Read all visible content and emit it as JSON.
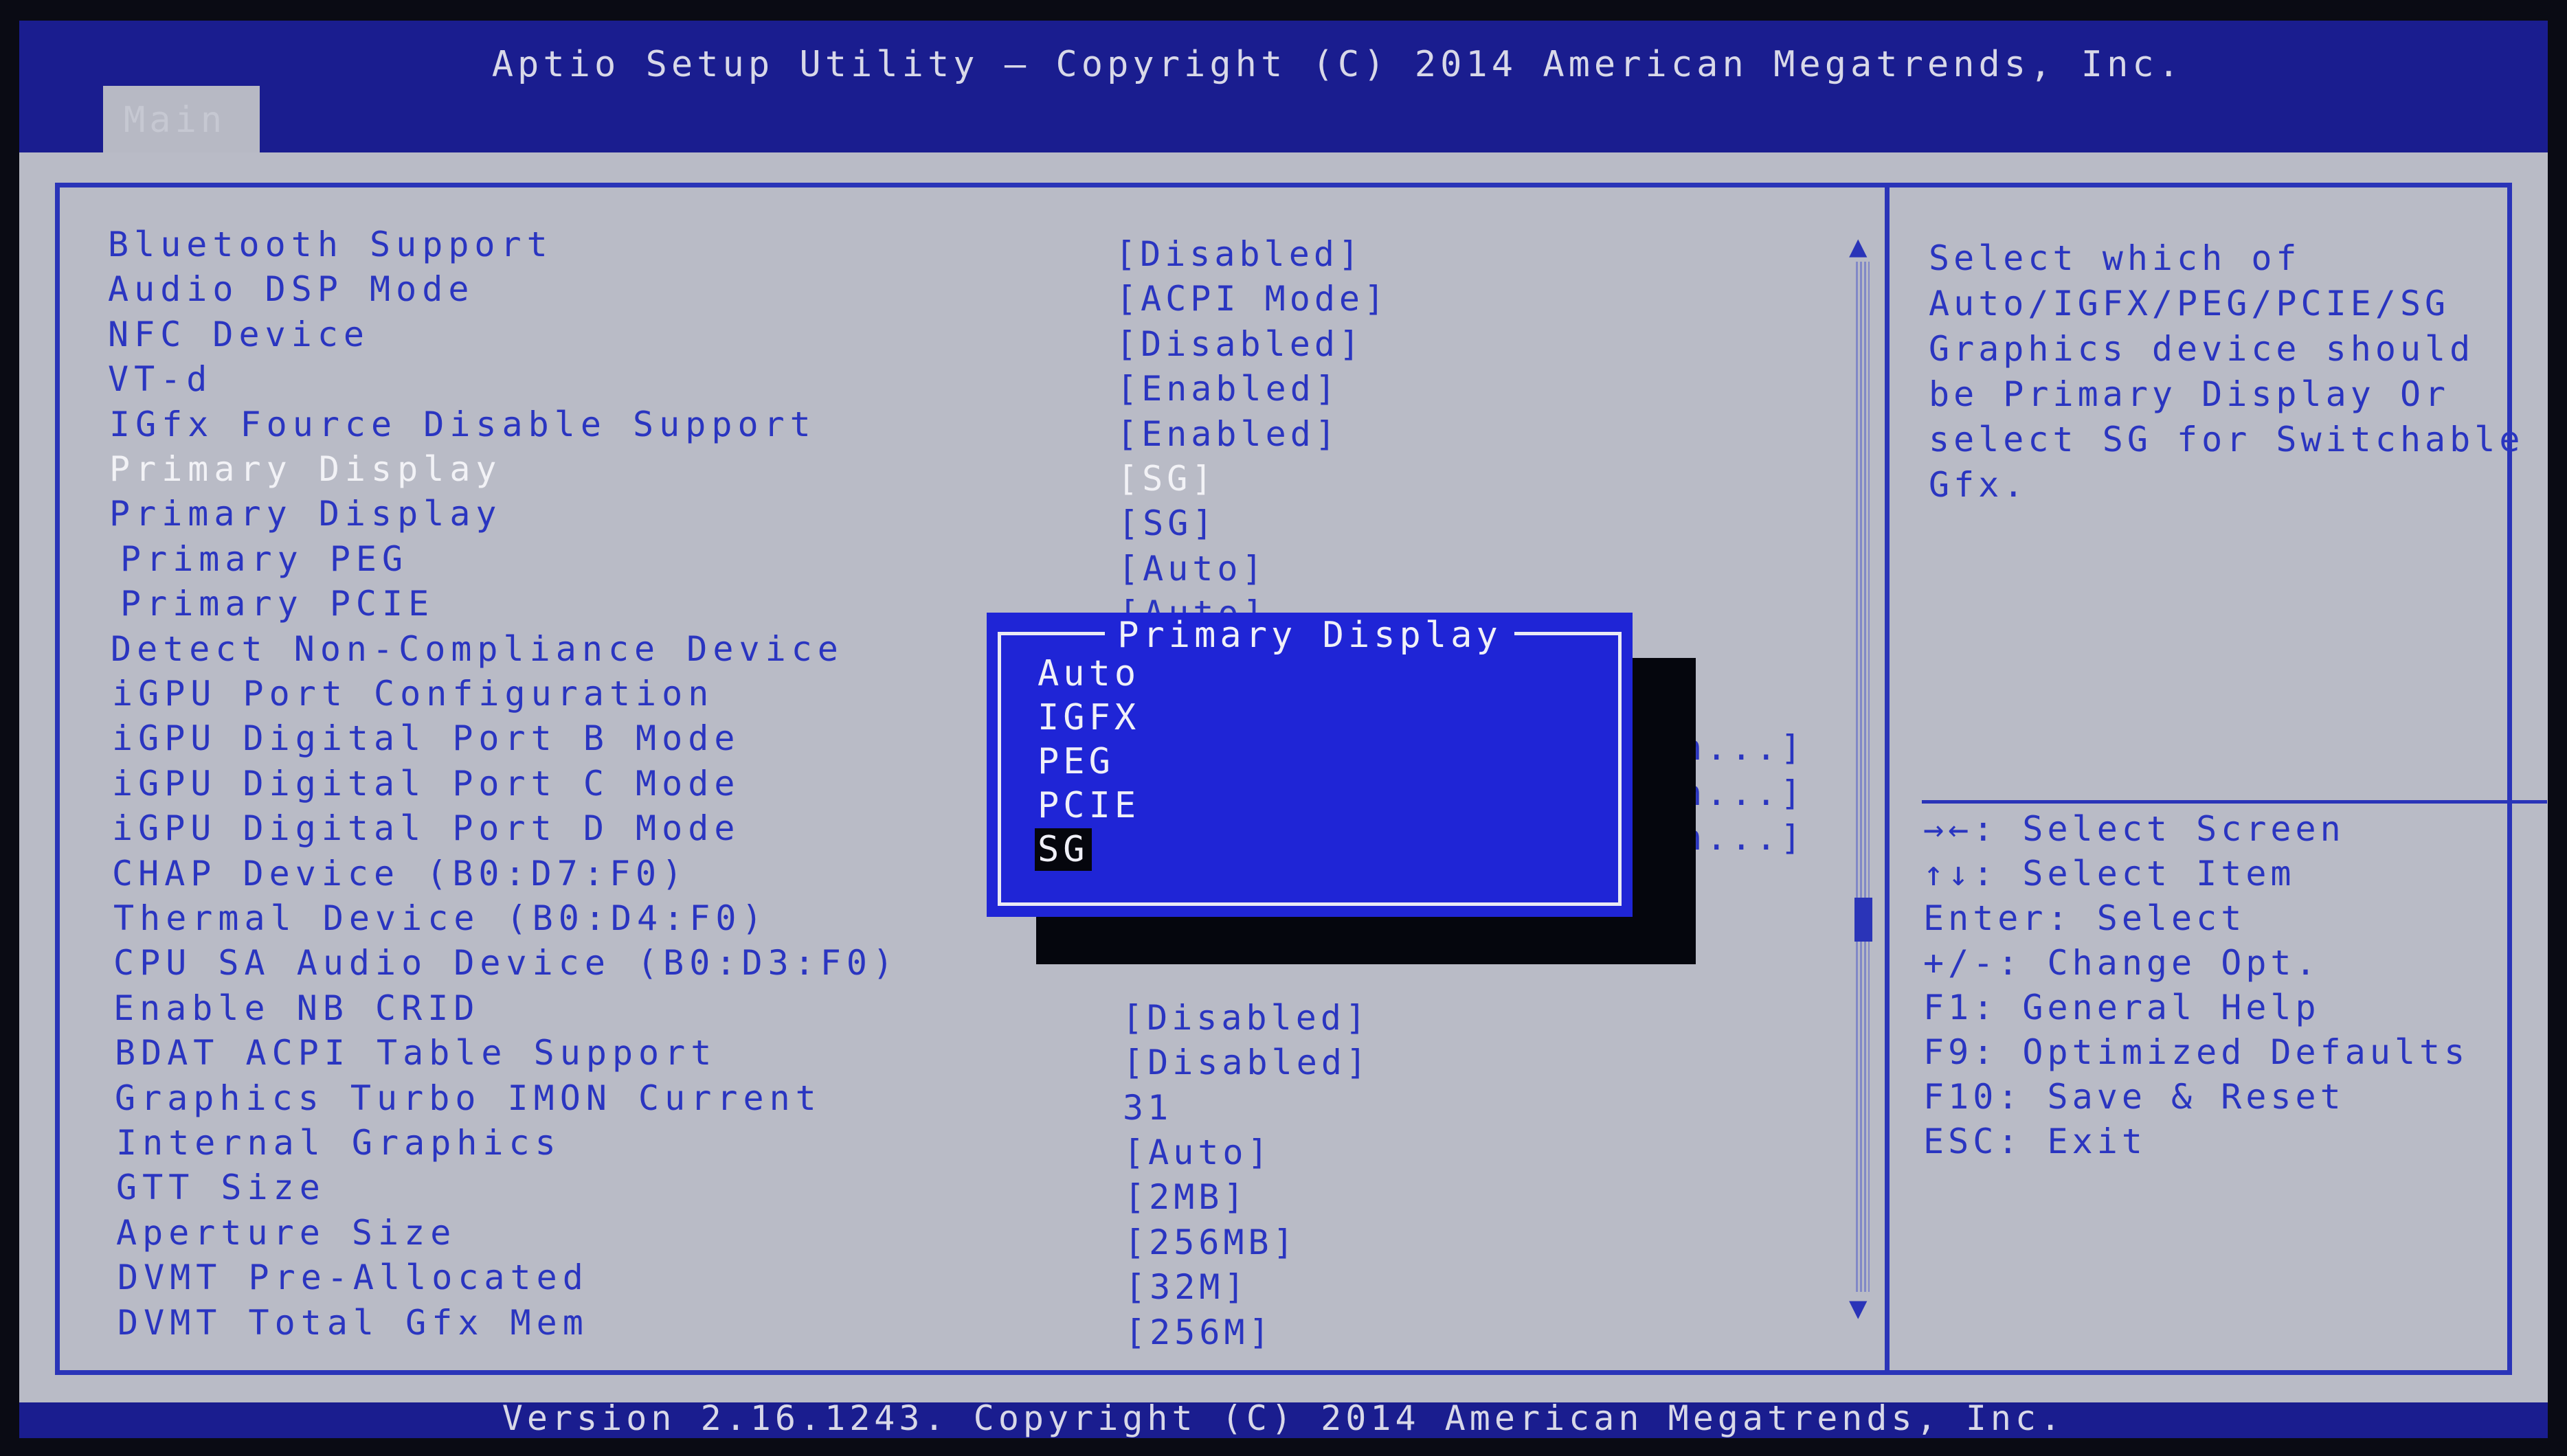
{
  "header": {
    "title": "Aptio Setup Utility – Copyright (C) 2014 American Megatrends, Inc.",
    "tab": "Main"
  },
  "items": [
    {
      "label": "Bluetooth Support",
      "value": "[Disabled]"
    },
    {
      "label": "Audio DSP Mode",
      "value": "[ACPI Mode]"
    },
    {
      "label": "NFC Device",
      "value": "[Disabled]"
    },
    {
      "label": "VT-d",
      "value": "[Enabled]"
    },
    {
      "label": "IGfx Fource Disable Support",
      "value": "[Enabled]"
    },
    {
      "label": "Primary Display",
      "value": "[SG]",
      "active": true
    },
    {
      "label": "Primary Display",
      "value": "[SG]"
    },
    {
      "label": " Primary PEG",
      "value": "[Auto]"
    },
    {
      "label": " Primary PCIE",
      "value": "[Auto]"
    },
    {
      "label": "Detect Non-Compliance Device",
      "value": ""
    },
    {
      "label": "iGPU Port Configuration",
      "value": ""
    },
    {
      "label": "iGPU Digital Port B Mode",
      "value": ""
    },
    {
      "label": "iGPU Digital Port C Mode",
      "value": ""
    },
    {
      "label": "iGPU Digital Port D Mode",
      "value": ""
    },
    {
      "label": "CHAP Device (B0:D7:F0)",
      "value": ""
    },
    {
      "label": "Thermal Device (B0:D4:F0)",
      "value": ""
    },
    {
      "label": "CPU SA Audio Device (B0:D3:F0)",
      "value": ""
    },
    {
      "label": "Enable NB CRID",
      "value": "[Disabled]"
    },
    {
      "label": "BDAT ACPI Table Support",
      "value": "[Disabled]"
    },
    {
      "label": "Graphics Turbo IMON Current",
      "value": "31"
    },
    {
      "label": "Internal Graphics",
      "value": "[Auto]"
    },
    {
      "label": "GTT Size",
      "value": "[2MB]"
    },
    {
      "label": "Aperture Size",
      "value": "[256MB]"
    },
    {
      "label": "DVMT Pre-Allocated",
      "value": "[32M]"
    },
    {
      "label": "DVMT Total Gfx Mem",
      "value": "[256M]"
    }
  ],
  "partial_values": [
    "h...]",
    "h...]",
    "h...]"
  ],
  "help": {
    "text": "Select which of Auto/IGFX/PEG/PCIE/SG Graphics device should be Primary Display Or select SG for Switchable Gfx.",
    "lines": [
      "Select which of",
      "Auto/IGFX/PEG/PCIE/SG",
      "Graphics device should",
      "be Primary Display Or",
      "select SG for Switchable",
      "Gfx."
    ]
  },
  "keys": [
    "→←: Select Screen",
    "↑↓: Select Item",
    "Enter: Select",
    "+/-: Change Opt.",
    "F1: General Help",
    "F9: Optimized Defaults",
    "F10: Save & Reset",
    "ESC: Exit"
  ],
  "popup": {
    "title": "Primary Display",
    "options": [
      "Auto",
      "IGFX",
      "PEG",
      "PCIE",
      "SG"
    ],
    "selected": "SG"
  },
  "footer": "Version 2.16.1243. Copyright (C) 2014 American Megatrends, Inc."
}
